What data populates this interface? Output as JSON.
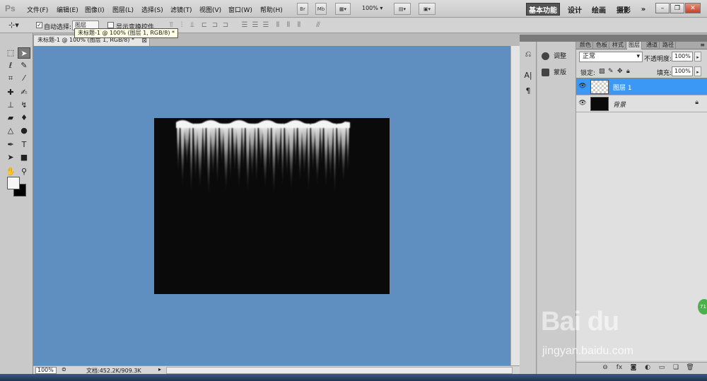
{
  "app": {
    "logo": "Ps"
  },
  "menu": [
    "文件(F)",
    "编辑(E)",
    "图像(I)",
    "图层(L)",
    "选择(S)",
    "滤镜(T)",
    "视图(V)",
    "窗口(W)",
    "帮助(H)"
  ],
  "menubar": {
    "bridge_label": "Br",
    "minibridge_label": "Mb",
    "zoom_level": "100%",
    "workspaces": [
      "基本功能",
      "设计",
      "绘画",
      "摄影"
    ],
    "more_workspaces": "»"
  },
  "options": {
    "auto_select_label": "自动选择:",
    "auto_select_value": "图层",
    "show_transform_label": "显示变换控件"
  },
  "document": {
    "tab_title": "未标题-1 @ 100% (图层 1, RGB/8) *",
    "tooltip": "未标题-1 @ 100% (图层 1, RGB/8) *",
    "status_zoom": "100%",
    "doc_info": "文档:452.2K/909.3K"
  },
  "adjust_panel": {
    "items": [
      "调整",
      "蒙版"
    ]
  },
  "layers_panel": {
    "tabs": [
      "颜色",
      "色板",
      "样式",
      "图层",
      "通道",
      "路径"
    ],
    "active_tab": "图层",
    "blend_mode": "正常",
    "opacity_label": "不透明度:",
    "opacity_value": "100%",
    "lock_label": "锁定:",
    "fill_label": "填充:",
    "fill_value": "100%",
    "layers": [
      {
        "name": "图层 1",
        "selected": true
      },
      {
        "name": "背景",
        "selected": false,
        "locked": true
      }
    ]
  },
  "watermark": {
    "brand": "Bai du",
    "site": "jingyan.baidu.com",
    "badge": "71"
  },
  "colors": {
    "canvas_bg": "#5f8fc0",
    "artboard": "#0a0a0a",
    "layer_selected": "#3b98f5"
  }
}
